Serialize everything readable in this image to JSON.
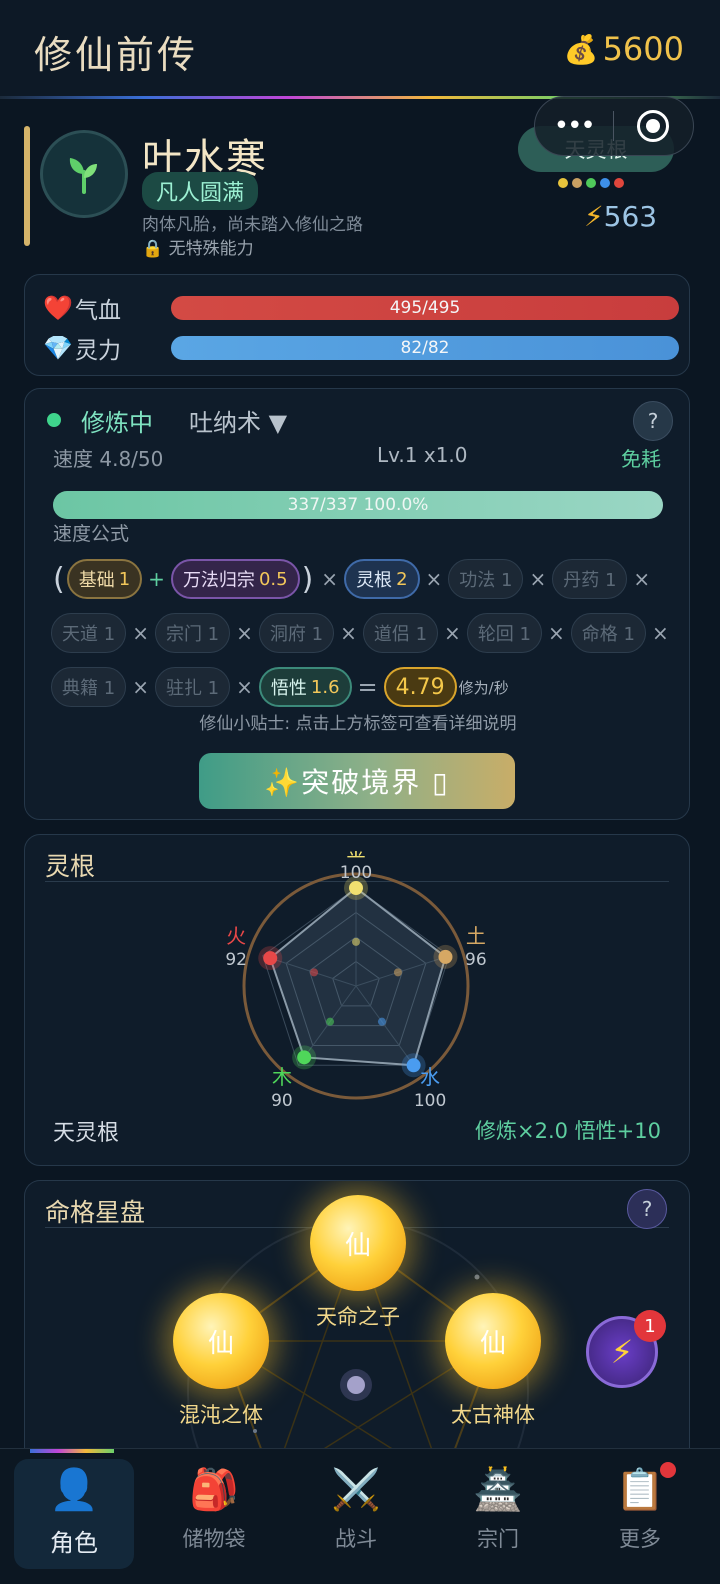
{
  "header": {
    "title": "修仙前传",
    "gold_icon": "money-bag-icon",
    "gold": "5600"
  },
  "profile": {
    "name": "叶水寒",
    "realm": "凡人圆满",
    "description": "肉体凡胎，尚未踏入修仙之路",
    "ability": "无特殊能力",
    "root_badge": "天灵根",
    "root_dot_colors": [
      "#e8c43c",
      "#c9a062",
      "#4fc95a",
      "#3d8fe8",
      "#e0463c"
    ],
    "power": "563"
  },
  "vitals": {
    "hp_label": "气血",
    "hp_text": "495/495",
    "hp_fraction": 1.0,
    "mp_label": "灵力",
    "mp_text": "82/82",
    "mp_fraction": 1.0
  },
  "cultivation": {
    "status": "修炼中",
    "technique": "吐纳术 ▼",
    "help": "?",
    "speed": "速度 4.8/50",
    "level": "Lv.1 x1.0",
    "cost": "免耗",
    "progress_text": "337/337  100.0%",
    "progress_fraction": 1.0,
    "formula_title": "速度公式",
    "f_base_label": "基础",
    "f_base_val": "1",
    "f_wf_label": "万法归宗",
    "f_wf_val": "0.5",
    "f_root_label": "灵根",
    "f_root_val": "2",
    "f_gongfa": "功法 1",
    "f_danyao": "丹药 1",
    "f_tiandao": "天道 1",
    "f_zongmen": "宗门 1",
    "f_dongfu": "洞府 1",
    "f_daolv": "道侣 1",
    "f_lunhui": "轮回 1",
    "f_mingge": "命格 1",
    "f_dianji": "典籍 1",
    "f_zhuzha": "驻扎 1",
    "f_wuxing_label": "悟性",
    "f_wuxing_val": "1.6",
    "f_result": "4.79",
    "f_unit": "修为/秒",
    "tip": "修仙小贴士: 点击上方标签可查看详细说明",
    "breakthrough": "✨突破境界 ▯"
  },
  "spirit_root": {
    "title": "灵根",
    "elements": [
      {
        "name": "金",
        "value": 100,
        "color": "#f0e070"
      },
      {
        "name": "土",
        "value": 96,
        "color": "#d6a864"
      },
      {
        "name": "水",
        "value": 100,
        "color": "#4a9cf0"
      },
      {
        "name": "木",
        "value": 90,
        "color": "#4fd65a"
      },
      {
        "name": "火",
        "value": 92,
        "color": "#e84848"
      }
    ],
    "max": 100,
    "type": "天灵根",
    "bonus": "修炼×2.0  悟性+10"
  },
  "fate": {
    "title": "命格星盘",
    "help": "?",
    "orb_glyph": "仙",
    "orbs": [
      "天命之子",
      "混沌之体",
      "太古神体"
    ],
    "button_icon": "⚡",
    "badge": "1"
  },
  "nav": [
    {
      "icon": "👤",
      "label": "角色"
    },
    {
      "icon": "🎒",
      "label": "储物袋"
    },
    {
      "icon": "⚔️",
      "label": "战斗"
    },
    {
      "icon": "🏯",
      "label": "宗门"
    },
    {
      "icon": "📋",
      "label": "更多"
    }
  ]
}
